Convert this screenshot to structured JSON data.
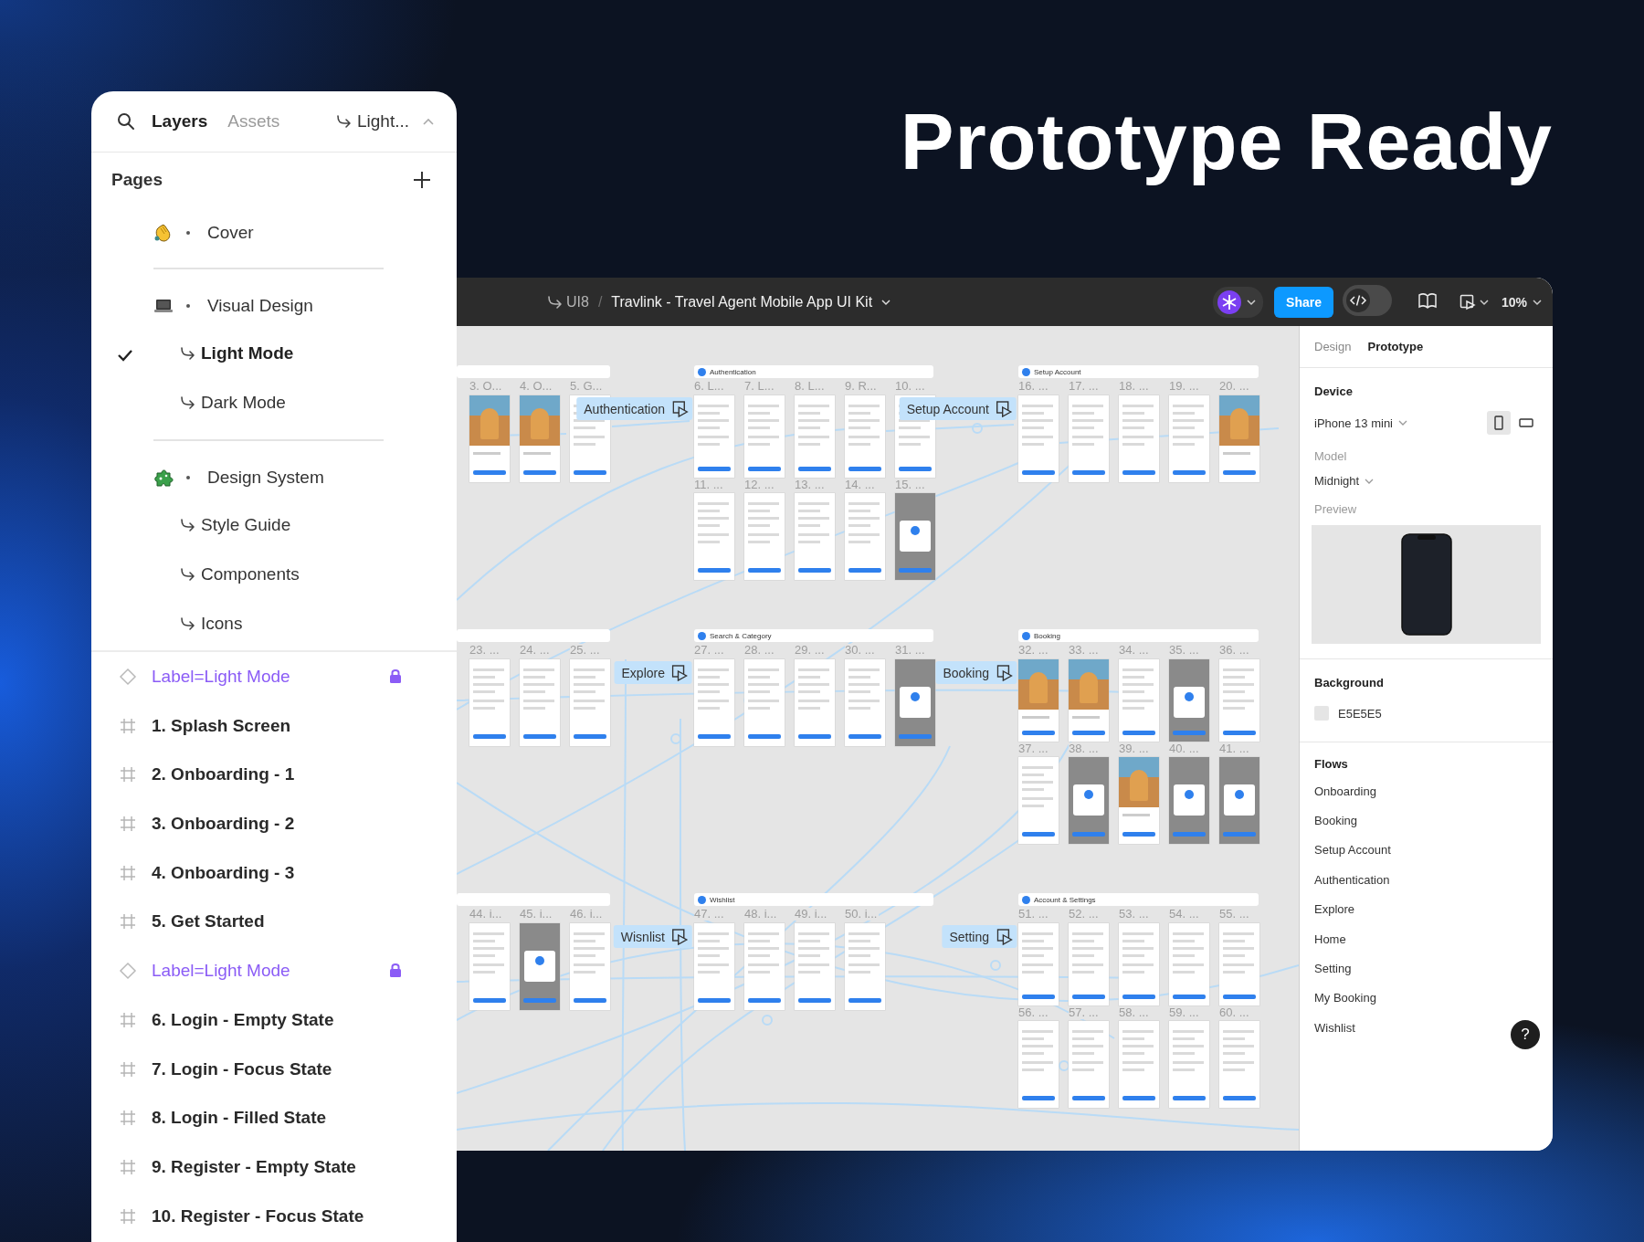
{
  "headline": "Prototype Ready",
  "layers_panel": {
    "tabs": [
      {
        "label": "Layers",
        "selected": true
      },
      {
        "label": "Assets",
        "selected": false
      }
    ],
    "page_switcher": "Light...",
    "pages_title": "Pages",
    "page_groups": [
      [
        {
          "label": "Cover",
          "kind": "page",
          "checked": false
        }
      ],
      [
        {
          "label": "Visual Design",
          "kind": "page",
          "checked": false
        },
        {
          "label": "Light Mode",
          "kind": "subpage",
          "checked": true
        },
        {
          "label": "Dark Mode",
          "kind": "subpage",
          "checked": false
        }
      ],
      [
        {
          "label": "Design System",
          "kind": "page",
          "checked": false
        },
        {
          "label": "Style Guide",
          "kind": "subpage",
          "checked": false
        },
        {
          "label": "Components",
          "kind": "subpage",
          "checked": false
        },
        {
          "label": "Icons",
          "kind": "subpage",
          "checked": false
        }
      ]
    ],
    "layers": [
      {
        "label": "Label=Light Mode",
        "kind": "component",
        "locked": true
      },
      {
        "label": "1. Splash Screen",
        "kind": "frame",
        "locked": false
      },
      {
        "label": "2. Onboarding - 1",
        "kind": "frame",
        "locked": false
      },
      {
        "label": "3. Onboarding - 2",
        "kind": "frame",
        "locked": false
      },
      {
        "label": "4. Onboarding - 3",
        "kind": "frame",
        "locked": false
      },
      {
        "label": "5. Get Started",
        "kind": "frame",
        "locked": false
      },
      {
        "label": "Label=Light Mode",
        "kind": "component",
        "locked": true
      },
      {
        "label": "6. Login - Empty State",
        "kind": "frame",
        "locked": false
      },
      {
        "label": "7. Login - Focus State",
        "kind": "frame",
        "locked": false
      },
      {
        "label": "8. Login - Filled State",
        "kind": "frame",
        "locked": false
      },
      {
        "label": "9. Register - Empty State",
        "kind": "frame",
        "locked": false
      },
      {
        "label": "10. Register - Focus State",
        "kind": "frame",
        "locked": false
      }
    ]
  },
  "top_bar": {
    "project": "UI8",
    "separator": "/",
    "file_name": "Travlink - Travel Agent Mobile App UI Kit",
    "share": "Share",
    "zoom": "10%"
  },
  "canvas": {
    "sections": [
      {
        "rows": [
          [
            "3. O...",
            "4. O...",
            "5. G..."
          ]
        ]
      },
      {
        "title": "Authentication",
        "flow_label": "Authentication",
        "rows": [
          [
            "6. L...",
            "7. L...",
            "8. L...",
            "9. R...",
            "10. ..."
          ],
          [
            "11. ...",
            "12. ...",
            "13. ...",
            "14. ...",
            "15. ..."
          ]
        ]
      },
      {
        "title": "Setup Account",
        "flow_label": "Setup Account",
        "rows": [
          [
            "16. ...",
            "17. ...",
            "18. ...",
            "19. ...",
            "20. ..."
          ]
        ]
      },
      {
        "rows": [
          [
            "23. ...",
            "24. ...",
            "25. ..."
          ]
        ]
      },
      {
        "title": "Search & Category",
        "flow_label": "Explore",
        "rows": [
          [
            "27. ...",
            "28. ...",
            "29. ...",
            "30. ...",
            "31. ..."
          ]
        ]
      },
      {
        "title": "Booking",
        "flow_label": "Booking",
        "rows": [
          [
            "32. ...",
            "33. ...",
            "34. ...",
            "35. ...",
            "36. ..."
          ],
          [
            "37. ...",
            "38. ...",
            "39. ...",
            "40. ...",
            "41. ..."
          ]
        ]
      },
      {
        "rows": [
          [
            "44. i...",
            "45. i...",
            "46. i..."
          ]
        ]
      },
      {
        "title": "Wishlist",
        "flow_label": "Wisnlist",
        "rows": [
          [
            "47. ...",
            "48. i...",
            "49. i...",
            "50. i..."
          ]
        ]
      },
      {
        "title": "Account & Settings",
        "flow_label": "Setting",
        "rows": [
          [
            "51. ...",
            "52. ...",
            "53. ...",
            "54. ...",
            "55. ..."
          ],
          [
            "56. ...",
            "57. ...",
            "58. ...",
            "59. ...",
            "60. ..."
          ]
        ]
      }
    ]
  },
  "prototype_panel": {
    "tabs": [
      {
        "label": "Design",
        "selected": false
      },
      {
        "label": "Prototype",
        "selected": true
      }
    ],
    "device_title": "Device",
    "device": "iPhone 13 mini",
    "orientations": [
      {
        "kind": "portrait",
        "selected": true
      },
      {
        "kind": "landscape",
        "selected": false
      }
    ],
    "model_label": "Model",
    "model": "Midnight",
    "preview_label": "Preview",
    "background_title": "Background",
    "background_color": "E5E5E5",
    "flows_title": "Flows",
    "flows": [
      "Onboarding",
      "Booking",
      "Setup Account",
      "Authentication",
      "Explore",
      "Home",
      "Setting",
      "My Booking",
      "Wishlist"
    ],
    "help": "?"
  }
}
